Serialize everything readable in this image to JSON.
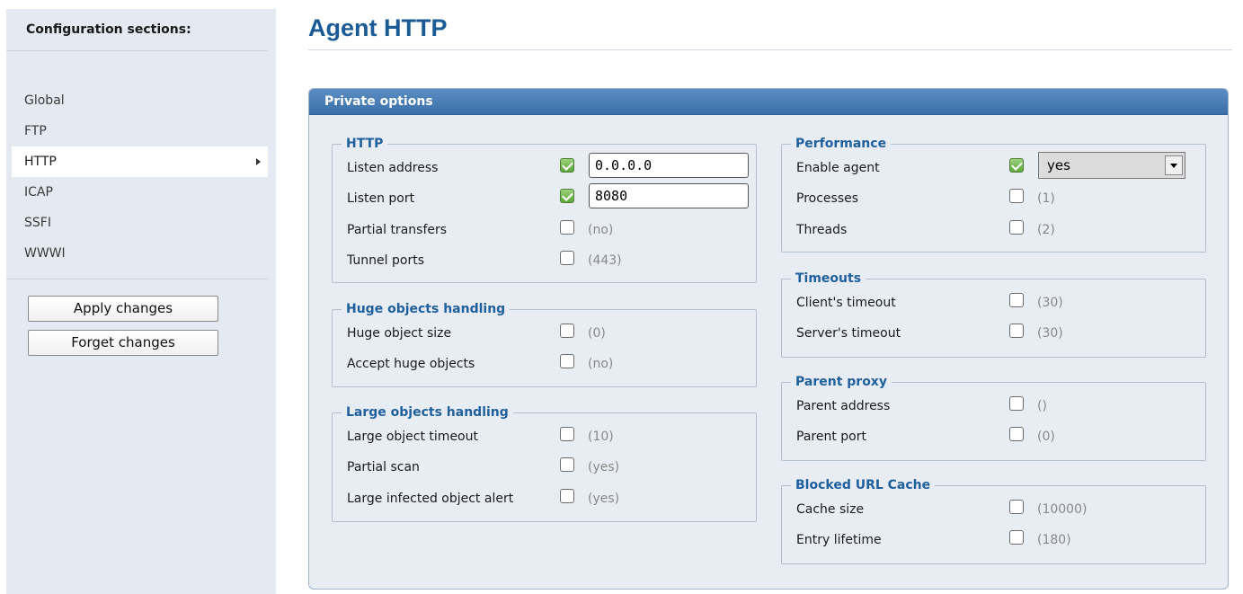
{
  "sidebar": {
    "header": "Configuration sections:",
    "items": [
      {
        "label": "Global"
      },
      {
        "label": "FTP"
      },
      {
        "label": "HTTP"
      },
      {
        "label": "ICAP"
      },
      {
        "label": "SSFI"
      },
      {
        "label": "WWWI"
      }
    ],
    "active_item": "HTTP",
    "apply_label": "Apply changes",
    "forget_label": "Forget changes"
  },
  "main": {
    "title": "Agent HTTP",
    "panel_title": "Private options",
    "http": {
      "legend": "HTTP",
      "rows": [
        {
          "label": "Listen address",
          "checked": true,
          "value": "0.0.0.0"
        },
        {
          "label": "Listen port",
          "checked": true,
          "value": "8080"
        },
        {
          "label": "Partial transfers",
          "checked": false,
          "default": "(no)"
        },
        {
          "label": "Tunnel ports",
          "checked": false,
          "default": "(443)"
        }
      ]
    },
    "huge": {
      "legend": "Huge objects handling",
      "rows": [
        {
          "label": "Huge object size",
          "checked": false,
          "default": "(0)"
        },
        {
          "label": "Accept huge objects",
          "checked": false,
          "default": "(no)"
        }
      ]
    },
    "large": {
      "legend": "Large objects handling",
      "rows": [
        {
          "label": "Large object timeout",
          "checked": false,
          "default": "(10)"
        },
        {
          "label": "Partial scan",
          "checked": false,
          "default": "(yes)"
        },
        {
          "label": "Large infected object alert",
          "checked": false,
          "default": "(yes)"
        }
      ]
    },
    "performance": {
      "legend": "Performance",
      "rows": [
        {
          "label": "Enable agent",
          "checked": true,
          "value": "yes"
        },
        {
          "label": "Processes",
          "checked": false,
          "default": "(1)"
        },
        {
          "label": "Threads",
          "checked": false,
          "default": "(2)"
        }
      ]
    },
    "timeouts": {
      "legend": "Timeouts",
      "rows": [
        {
          "label": "Client's timeout",
          "checked": false,
          "default": "(30)"
        },
        {
          "label": "Server's timeout",
          "checked": false,
          "default": "(30)"
        }
      ]
    },
    "parent": {
      "legend": "Parent proxy",
      "rows": [
        {
          "label": "Parent address",
          "checked": false,
          "default": "()"
        },
        {
          "label": "Parent port",
          "checked": false,
          "default": "(0)"
        }
      ]
    },
    "cache": {
      "legend": "Blocked URL Cache",
      "rows": [
        {
          "label": "Cache size",
          "checked": false,
          "default": "(10000)"
        },
        {
          "label": "Entry lifetime",
          "checked": false,
          "default": "(180)"
        }
      ]
    }
  }
}
